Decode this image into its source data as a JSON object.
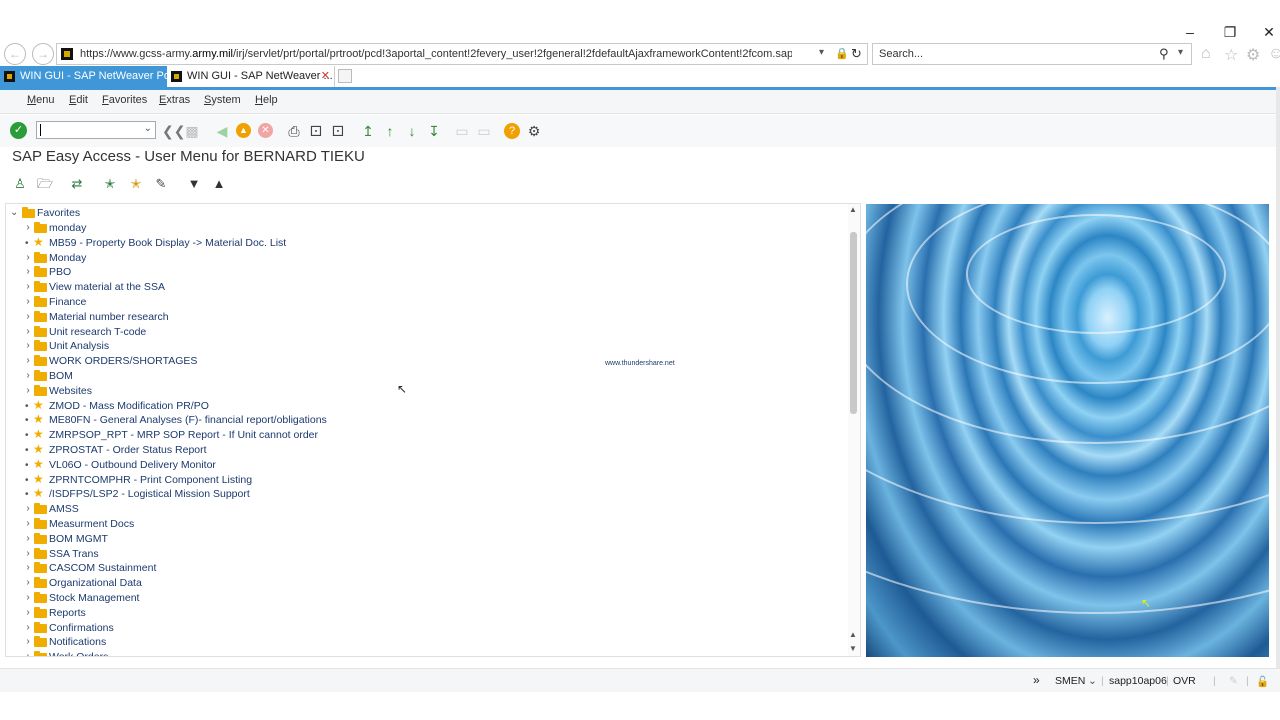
{
  "browser": {
    "url_prefix": "https://www.gcss-army.",
    "url_domain": "army.mil",
    "url_rest": "/irj/servlet/prt/portal/prtroot/pcd!3aportal_content!2fevery_user!2fgeneral!2fdefaultAjaxframeworkContent!2fcom.sap.portal.standalo",
    "search_placeholder": "Search...",
    "tabs": [
      {
        "label": "WIN GUI - SAP NetWeaver Port..."
      },
      {
        "label": "WIN GUI - SAP NetWeaver ..."
      }
    ]
  },
  "menubar": {
    "items": [
      "Menu",
      "Edit",
      "Favorites",
      "Extras",
      "System",
      "Help"
    ]
  },
  "page": {
    "title": "SAP Easy Access  -  User Menu for BERNARD TIEKU"
  },
  "tree": {
    "root": "Favorites",
    "items": [
      {
        "label": "monday",
        "type": "folder"
      },
      {
        "label": "MB59 - Property Book Display -> Material Doc. List",
        "type": "transaction"
      },
      {
        "label": "Monday",
        "type": "folder"
      },
      {
        "label": "PBO",
        "type": "folder"
      },
      {
        "label": "View material at the SSA",
        "type": "folder"
      },
      {
        "label": "Finance",
        "type": "folder"
      },
      {
        "label": "Material number research",
        "type": "folder"
      },
      {
        "label": "Unit research T-code",
        "type": "folder"
      },
      {
        "label": "Unit Analysis",
        "type": "folder"
      },
      {
        "label": "WORK ORDERS/SHORTAGES",
        "type": "folder"
      },
      {
        "label": "BOM",
        "type": "folder"
      },
      {
        "label": "Websites",
        "type": "folder"
      },
      {
        "label": "ZMOD - Mass Modification PR/PO",
        "type": "transaction"
      },
      {
        "label": "ME80FN - General Analyses (F)- financial report/obligations",
        "type": "transaction"
      },
      {
        "label": "ZMRPSOP_RPT - MRP SOP Report - If Unit cannot order",
        "type": "transaction"
      },
      {
        "label": "ZPROSTAT - Order Status Report",
        "type": "transaction"
      },
      {
        "label": "VL06O - Outbound Delivery Monitor",
        "type": "transaction"
      },
      {
        "label": "ZPRNTCOMPHR - Print Component Listing",
        "type": "transaction"
      },
      {
        "label": "/ISDFPS/LSP2 - Logistical Mission Support",
        "type": "transaction"
      },
      {
        "label": "AMSS",
        "type": "folder"
      },
      {
        "label": "Measurment Docs",
        "type": "folder"
      },
      {
        "label": "BOM MGMT",
        "type": "folder"
      },
      {
        "label": "SSA Trans",
        "type": "folder"
      },
      {
        "label": "CASCOM Sustainment",
        "type": "folder"
      },
      {
        "label": "Organizational Data",
        "type": "folder"
      },
      {
        "label": "Stock Management",
        "type": "folder"
      },
      {
        "label": "Reports",
        "type": "folder"
      },
      {
        "label": "Confirmations",
        "type": "folder"
      },
      {
        "label": "Notifications",
        "type": "folder"
      },
      {
        "label": "Work Orders",
        "type": "folder"
      }
    ]
  },
  "watermark": "www.thundershare.net",
  "status": {
    "transaction": "SMEN",
    "server": "sapp10ap06",
    "mode": "OVR"
  },
  "colors": {
    "accent": "#3f97d8",
    "folder": "#f0ad00",
    "tree_text": "#1c3a6e"
  }
}
